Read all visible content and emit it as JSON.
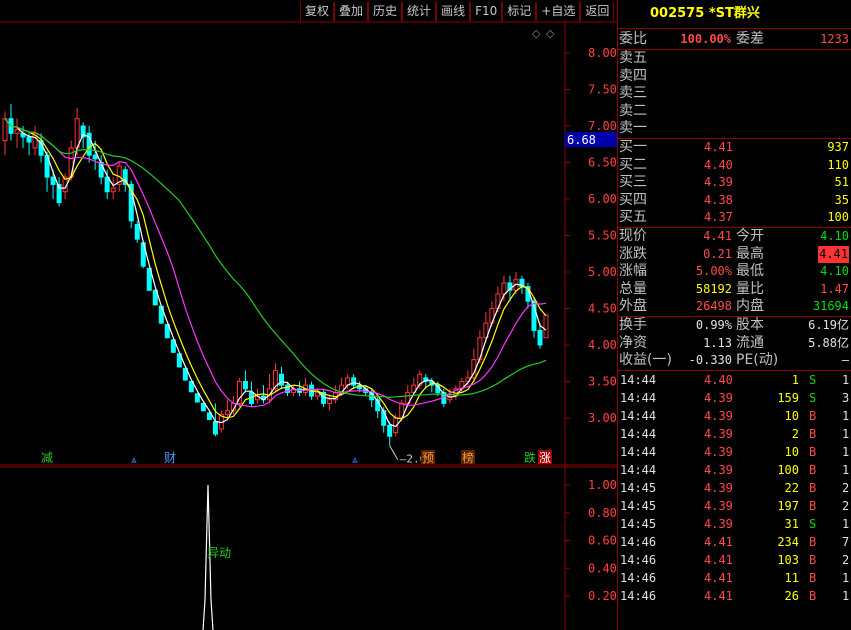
{
  "toolbar": {
    "items": [
      "复权",
      "叠加",
      "历史",
      "统计",
      "画线",
      "F10",
      "标记",
      "+自选",
      "返回"
    ]
  },
  "chart": {
    "price_axis": [
      "8.00",
      "7.50",
      "7.00",
      "6.50",
      "6.00",
      "5.50",
      "5.00",
      "4.50",
      "4.00",
      "3.50",
      "3.00"
    ],
    "current_price_tag": "6.68",
    "low_annotation": "2.62",
    "event_marks": [
      "减",
      "财",
      "预",
      "榜",
      "跌",
      "涨"
    ],
    "indicator_axis": [
      "1.00",
      "0.80",
      "0.60",
      "0.40",
      "0.20"
    ],
    "indicator_label": "异动",
    "colors": {
      "ma1": "#ffffff",
      "ma2": "#ffff00",
      "ma3": "#ff33ff",
      "ma4": "#22cc22",
      "up": "#ff3333",
      "down": "#00ffff",
      "axis": "#8b0000"
    }
  },
  "quote": {
    "code": "002575",
    "name": "*ST群兴",
    "webi_label": "委比",
    "webi_value": "100.00%",
    "weicha_label": "委差",
    "weicha_value": "1233",
    "asks": [
      {
        "label": "卖五",
        "price": "",
        "vol": ""
      },
      {
        "label": "卖四",
        "price": "",
        "vol": ""
      },
      {
        "label": "卖三",
        "price": "",
        "vol": ""
      },
      {
        "label": "卖二",
        "price": "",
        "vol": ""
      },
      {
        "label": "卖一",
        "price": "",
        "vol": ""
      }
    ],
    "bids": [
      {
        "label": "买一",
        "price": "4.41",
        "vol": "937"
      },
      {
        "label": "买二",
        "price": "4.40",
        "vol": "110"
      },
      {
        "label": "买三",
        "price": "4.39",
        "vol": "51"
      },
      {
        "label": "买四",
        "price": "4.38",
        "vol": "35"
      },
      {
        "label": "买五",
        "price": "4.37",
        "vol": "100"
      }
    ],
    "stats": [
      {
        "l1": "现价",
        "v1": "4.41",
        "c1": "red",
        "l2": "今开",
        "v2": "4.10",
        "c2": "green"
      },
      {
        "l1": "涨跌",
        "v1": "0.21",
        "c1": "red",
        "l2": "最高",
        "v2": "4.41",
        "c2": "redbox"
      },
      {
        "l1": "涨幅",
        "v1": "5.00%",
        "c1": "red",
        "l2": "最低",
        "v2": "4.10",
        "c2": "green"
      },
      {
        "l1": "总量",
        "v1": "58192",
        "c1": "yellow",
        "l2": "量比",
        "v2": "1.47",
        "c2": "red"
      },
      {
        "l1": "外盘",
        "v1": "26498",
        "c1": "red",
        "l2": "内盘",
        "v2": "31694",
        "c2": "green"
      }
    ],
    "stats2": [
      {
        "l1": "换手",
        "v1": "0.99%",
        "l2": "股本",
        "v2": "6.19亿"
      },
      {
        "l1": "净资",
        "v1": "1.13",
        "l2": "流通",
        "v2": "5.88亿"
      },
      {
        "l1": "收益(一)",
        "v1": "-0.330",
        "l2": "PE(动)",
        "v2": "—"
      }
    ],
    "ticks": [
      {
        "t": "14:44",
        "p": "4.40",
        "v": "1",
        "s": "S",
        "n": "1"
      },
      {
        "t": "14:44",
        "p": "4.39",
        "v": "159",
        "s": "S",
        "n": "3"
      },
      {
        "t": "14:44",
        "p": "4.39",
        "v": "10",
        "s": "B",
        "n": "1"
      },
      {
        "t": "14:44",
        "p": "4.39",
        "v": "2",
        "s": "B",
        "n": "1"
      },
      {
        "t": "14:44",
        "p": "4.39",
        "v": "10",
        "s": "B",
        "n": "1"
      },
      {
        "t": "14:44",
        "p": "4.39",
        "v": "100",
        "s": "B",
        "n": "1"
      },
      {
        "t": "14:45",
        "p": "4.39",
        "v": "22",
        "s": "B",
        "n": "2"
      },
      {
        "t": "14:45",
        "p": "4.39",
        "v": "197",
        "s": "B",
        "n": "2"
      },
      {
        "t": "14:45",
        "p": "4.39",
        "v": "31",
        "s": "S",
        "n": "1"
      },
      {
        "t": "14:46",
        "p": "4.41",
        "v": "234",
        "s": "B",
        "n": "7"
      },
      {
        "t": "14:46",
        "p": "4.41",
        "v": "103",
        "s": "B",
        "n": "2"
      },
      {
        "t": "14:46",
        "p": "4.41",
        "v": "11",
        "s": "B",
        "n": "1"
      },
      {
        "t": "14:46",
        "p": "4.41",
        "v": "26",
        "s": "B",
        "n": "1"
      }
    ]
  }
}
